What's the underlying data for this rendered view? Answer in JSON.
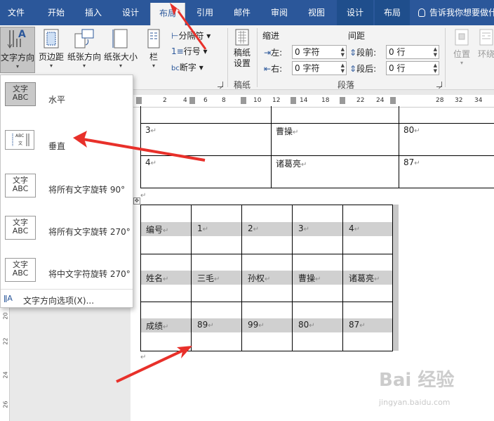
{
  "tabs": [
    "文件",
    "开始",
    "插入",
    "设计",
    "布局",
    "引用",
    "邮件",
    "审阅",
    "视图",
    "设计",
    "布局"
  ],
  "tell_me": "告诉我你想要做什",
  "ribbon": {
    "text_direction": "文字方向",
    "margins": "页边距",
    "orientation": "纸张方向",
    "size": "纸张大小",
    "columns": "栏",
    "breaks": "分隔符",
    "line_numbers": "行号",
    "hyphenation": "断字",
    "manuscript": "稿纸\n设置",
    "manuscript_group": "稿纸",
    "indent": "缩进",
    "indent_left": "左:",
    "indent_right": "右:",
    "indent_left_val": "0 字符",
    "indent_right_val": "0 字符",
    "spacing": "间距",
    "spacing_before": "段前:",
    "spacing_after": "段后:",
    "spacing_before_val": "0 行",
    "spacing_after_val": "0 行",
    "paragraph_group": "段落",
    "position": "位置",
    "wrap": "环绕"
  },
  "dropdown": {
    "items": [
      {
        "label": "水平",
        "box": "文字\nABC"
      },
      {
        "label": "垂直",
        "box": ""
      },
      {
        "label": "将所有文字旋转 90°",
        "box": "文字\nABC"
      },
      {
        "label": "将所有文字旋转 270°",
        "box": "文字\nABC"
      },
      {
        "label": "将中文字符旋转 270°",
        "box": "文字\nABC"
      }
    ],
    "options": "文字方向选项(X)..."
  },
  "ruler_numbers": [
    "2",
    "4",
    "6",
    "8",
    "10",
    "12",
    "14",
    "16",
    "18",
    "22",
    "24",
    "28",
    "32",
    "34"
  ],
  "vruler_numbers": [
    "20",
    "22",
    "24",
    "26"
  ],
  "table1": [
    [
      "3",
      "曹操",
      "80"
    ],
    [
      "4",
      "诸葛亮",
      "87"
    ]
  ],
  "table2": {
    "rows": [
      [
        "编号",
        "1",
        "2",
        "3",
        "4"
      ],
      [
        "姓名",
        "三毛",
        "孙权",
        "曹操",
        "诸葛亮"
      ],
      [
        "成绩",
        "89",
        "99",
        "80",
        "87"
      ]
    ]
  },
  "para_mark": "↵",
  "watermark": "Bai 经验",
  "watermark_sub": "jingyan.baidu.com"
}
